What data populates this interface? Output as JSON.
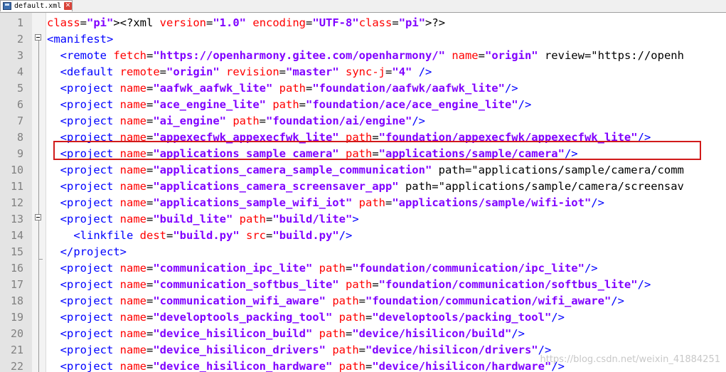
{
  "tab": {
    "title": "default.xml",
    "save_icon": "floppy-save-icon",
    "close_icon": "close-icon"
  },
  "colors": {
    "tag": "#0000ff",
    "attr": "#ff0000",
    "value": "#8000ff",
    "highlight_border": "#d11a1a"
  },
  "lines": [
    {
      "n": "1",
      "code": "<?xml version=\"1.0\" encoding=\"UTF-8\"?>"
    },
    {
      "n": "2",
      "code": "<manifest>"
    },
    {
      "n": "3",
      "code": "  <remote fetch=\"https://openharmony.gitee.com/openharmony/\" name=\"origin\" review=\"https://openh"
    },
    {
      "n": "4",
      "code": "  <default remote=\"origin\" revision=\"master\" sync-j=\"4\" />"
    },
    {
      "n": "5",
      "code": "  <project name=\"aafwk_aafwk_lite\" path=\"foundation/aafwk/aafwk_lite\"/>"
    },
    {
      "n": "6",
      "code": "  <project name=\"ace_engine_lite\" path=\"foundation/ace/ace_engine_lite\"/>"
    },
    {
      "n": "7",
      "code": "  <project name=\"ai_engine\" path=\"foundation/ai/engine\"/>"
    },
    {
      "n": "8",
      "code": "  <project name=\"appexecfwk_appexecfwk_lite\" path=\"foundation/appexecfwk/appexecfwk_lite\"/>"
    },
    {
      "n": "9",
      "code": "  <project name=\"applications_sample_camera\" path=\"applications/sample/camera\"/>"
    },
    {
      "n": "10",
      "code": "  <project name=\"applications_camera_sample_communication\" path=\"applications/sample/camera/comm"
    },
    {
      "n": "11",
      "code": "  <project name=\"applications_camera_screensaver_app\" path=\"applications/sample/camera/screensav"
    },
    {
      "n": "12",
      "code": "  <project name=\"applications_sample_wifi_iot\" path=\"applications/sample/wifi-iot\"/>"
    },
    {
      "n": "13",
      "code": "  <project name=\"build_lite\" path=\"build/lite\">"
    },
    {
      "n": "14",
      "code": "    <linkfile dest=\"build.py\" src=\"build.py\"/>"
    },
    {
      "n": "15",
      "code": "  </project>"
    },
    {
      "n": "16",
      "code": "  <project name=\"communication_ipc_lite\" path=\"foundation/communication/ipc_lite\"/>"
    },
    {
      "n": "17",
      "code": "  <project name=\"communication_softbus_lite\" path=\"foundation/communication/softbus_lite\"/>"
    },
    {
      "n": "18",
      "code": "  <project name=\"communication_wifi_aware\" path=\"foundation/communication/wifi_aware\"/>"
    },
    {
      "n": "19",
      "code": "  <project name=\"developtools_packing_tool\" path=\"developtools/packing_tool\"/>"
    },
    {
      "n": "20",
      "code": "  <project name=\"device_hisilicon_build\" path=\"device/hisilicon/build\"/>"
    },
    {
      "n": "21",
      "code": "  <project name=\"device_hisilicon_drivers\" path=\"device/hisilicon/drivers\"/>"
    },
    {
      "n": "22",
      "code": "  <project name=\"device_hisilicon_hardware\" path=\"device/hisilicon/hardware\"/>"
    }
  ],
  "watermark": "https://blog.csdn.net/weixin_41884251"
}
